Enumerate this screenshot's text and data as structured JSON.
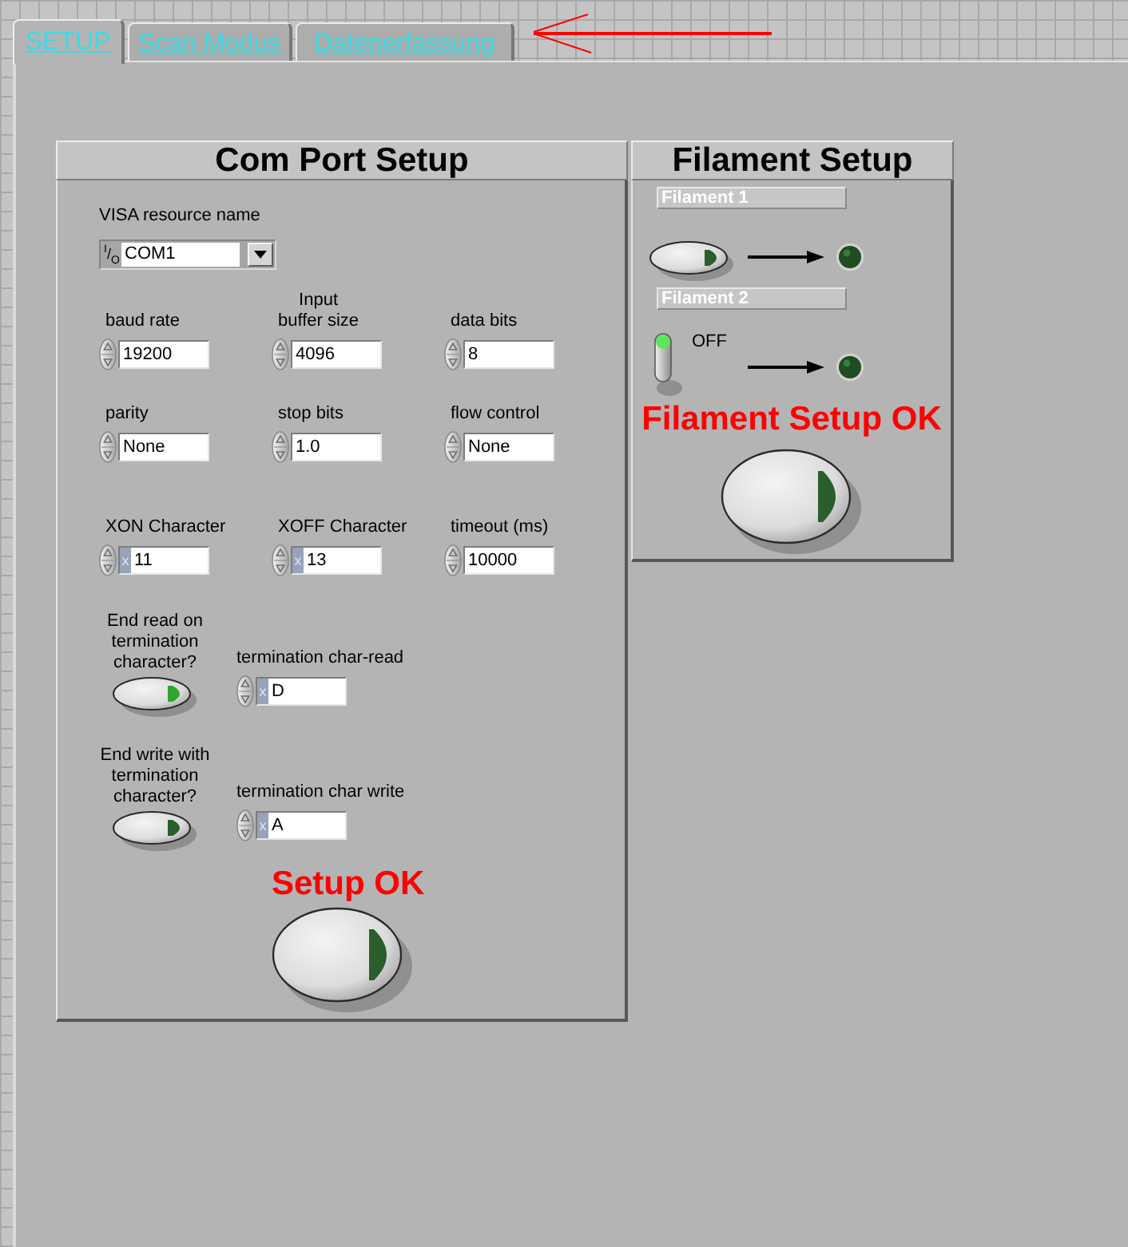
{
  "tabs": [
    {
      "label": "SETUP",
      "selected": true
    },
    {
      "label": "Scan Modus",
      "selected": false
    },
    {
      "label": "Datenerfassung",
      "selected": false
    }
  ],
  "com_port_setup": {
    "title": "Com Port Setup",
    "visa_resource": {
      "label": "VISA resource name",
      "io_glyph": "$^{I}$/$_{O}$",
      "value": "COM1"
    },
    "rows": [
      [
        {
          "label": "baud rate",
          "value": "19200"
        },
        {
          "label": "Input\nbuffer size",
          "value": "4096"
        },
        {
          "label": "data bits",
          "value": "8"
        }
      ],
      [
        {
          "label": "parity",
          "value": "None"
        },
        {
          "label": "stop bits",
          "value": "1.0"
        },
        {
          "label": "flow control",
          "value": "None"
        }
      ],
      [
        {
          "label": "XON Character",
          "radix": "x",
          "value": "11"
        },
        {
          "label": "XOFF Character",
          "radix": "x",
          "value": "13"
        },
        {
          "label": "timeout (ms)",
          "value": "10000"
        }
      ]
    ],
    "termination": [
      {
        "question": "End read on\ntermination\ncharacter?",
        "on": true,
        "char_label": "termination char-read",
        "radix": "x",
        "value": "D"
      },
      {
        "question": "End write with\ntermination\ncharacter?",
        "on": false,
        "char_label": "termination char write",
        "radix": "x",
        "value": "A"
      }
    ],
    "ok_label": "Setup OK",
    "ok_button": {
      "on": false
    }
  },
  "filament_setup": {
    "title": "Filament Setup",
    "filaments": [
      {
        "label": "Filament 1",
        "kind": "button",
        "on": false,
        "led_on": false
      },
      {
        "label": "Filament 2",
        "kind": "switch",
        "on": false,
        "state_text": "OFF",
        "led_on": false
      }
    ],
    "ok_label": "Filament Setup OK",
    "ok_button": {
      "on": false
    }
  }
}
